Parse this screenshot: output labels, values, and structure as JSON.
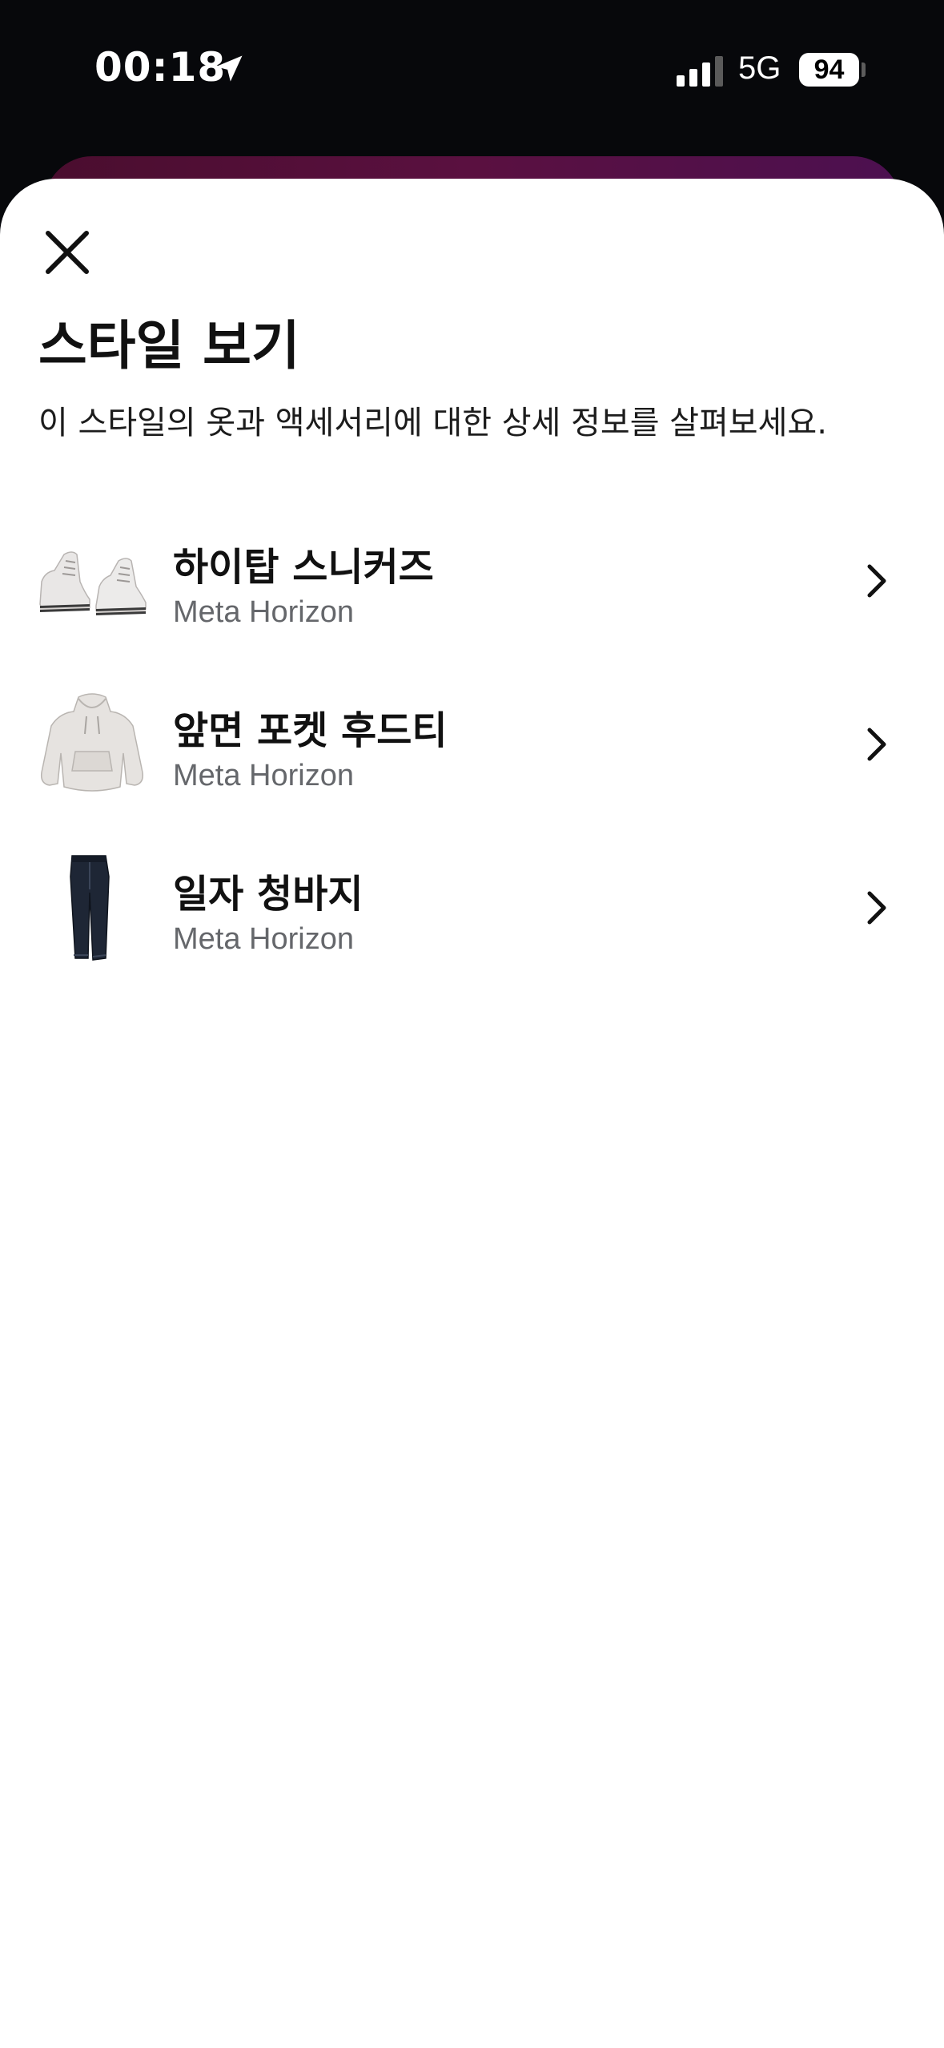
{
  "status_bar": {
    "time": "00:18",
    "network": "5G",
    "battery": "94"
  },
  "sheet": {
    "title": "스타일 보기",
    "description": "이 스타일의 옷과 액세서리에 대한 상세 정보를 살펴보세요.",
    "items": [
      {
        "name": "하이탑 스니커즈",
        "brand": "Meta Horizon",
        "icon": "sneakers-thumbnail"
      },
      {
        "name": "앞면 포켓 후드티",
        "brand": "Meta Horizon",
        "icon": "hoodie-thumbnail"
      },
      {
        "name": "일자 청바지",
        "brand": "Meta Horizon",
        "icon": "jeans-thumbnail"
      }
    ]
  },
  "colors": {
    "background": "#07080b",
    "sheet": "#ffffff",
    "subtext": "#65676b"
  }
}
